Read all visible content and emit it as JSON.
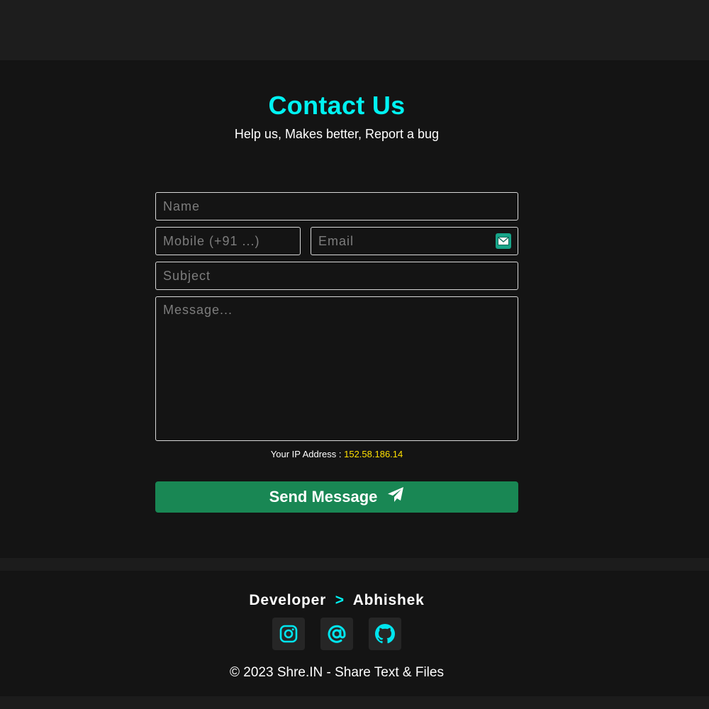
{
  "header": {
    "title": "Contact Us",
    "subtitle": "Help us, Makes better, Report a bug"
  },
  "form": {
    "name_placeholder": "Name",
    "mobile_placeholder": "Mobile (+91 ...)",
    "email_placeholder": "Email",
    "subject_placeholder": "Subject",
    "message_placeholder": "Message...",
    "email_badge_icon": "temp-mail-icon",
    "send_label": "Send Message",
    "send_icon": "paper-plane-icon"
  },
  "ip": {
    "label": "Your IP Address :",
    "value": "152.58.186.14"
  },
  "footer": {
    "developer_label": "Developer",
    "developer_separator": ">",
    "developer_name": "Abhishek",
    "social_icons": [
      "instagram-icon",
      "at-sign-icon",
      "github-icon"
    ],
    "copyright": "©  2023  Shre.IN - Share Text & Files"
  },
  "colors": {
    "accent": "#00f2f2",
    "ip_value": "#ffe000",
    "send_button": "#198754",
    "background": "#141414"
  }
}
